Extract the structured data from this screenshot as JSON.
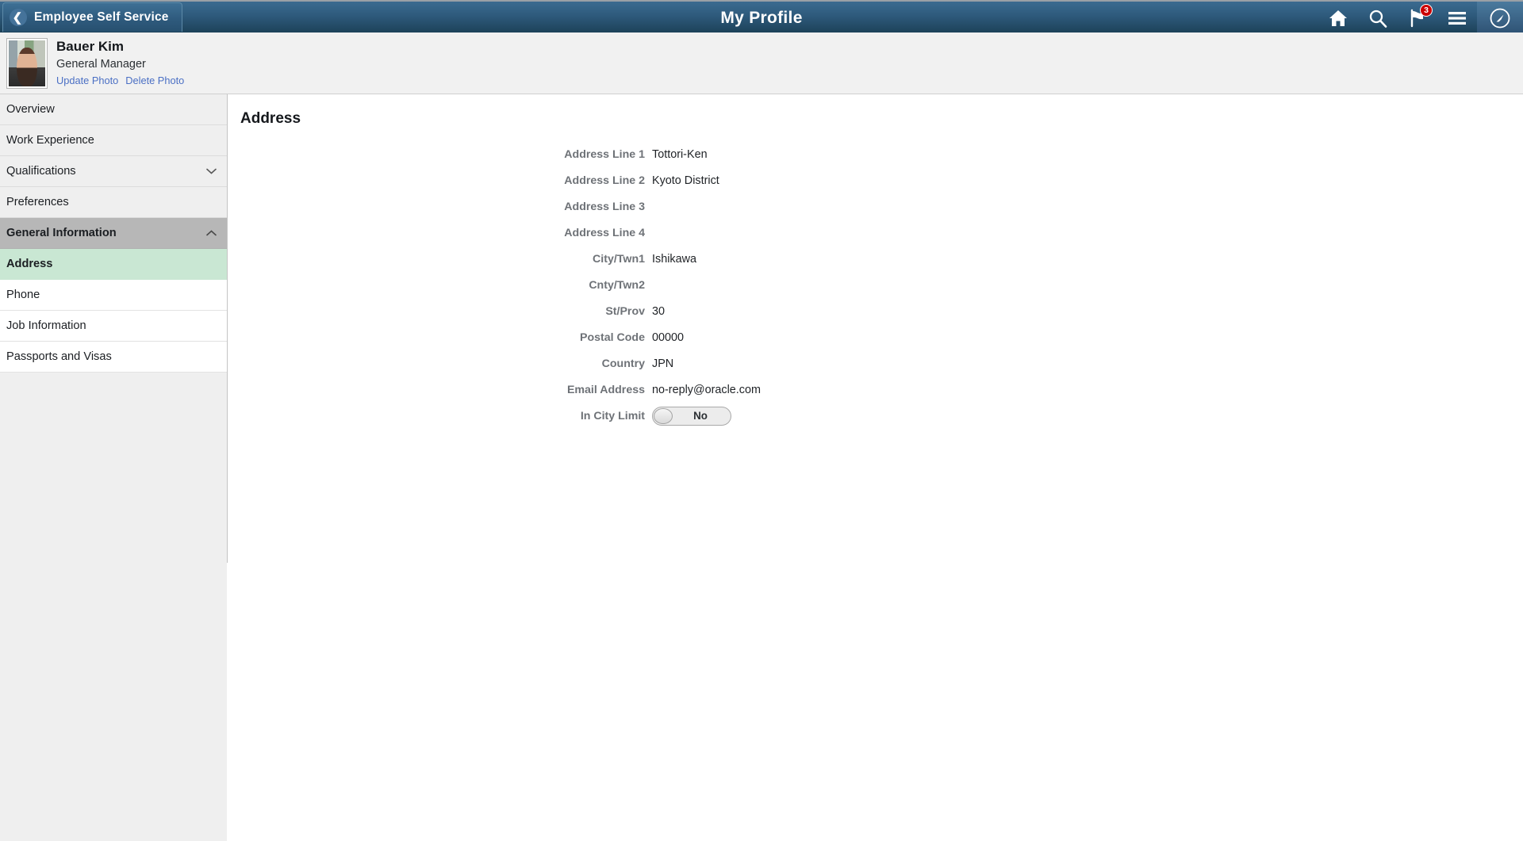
{
  "header": {
    "back_label": "Employee Self Service",
    "back_icon": "chevron-left-icon",
    "title": "My Profile",
    "icons": [
      {
        "name": "home-icon",
        "label": "Home"
      },
      {
        "name": "search-icon",
        "label": "Search"
      },
      {
        "name": "notifications-flag-icon",
        "label": "Notifications",
        "badge": "3"
      },
      {
        "name": "actions-menu-icon",
        "label": "Actions List"
      },
      {
        "name": "navbar-compass-icon",
        "label": "NavBar"
      }
    ],
    "colors": {
      "bar_top": "#3b6b90",
      "bar_bottom": "#1d4259",
      "badge": "#cc0000"
    }
  },
  "profile": {
    "avatar_name": "employee-photo",
    "name": "Bauer Kim",
    "role": "General Manager",
    "links": [
      {
        "name": "update-photo-link",
        "label": "Update Photo"
      },
      {
        "name": "delete-photo-link",
        "label": "Delete Photo"
      }
    ],
    "link_color": "#4a6fc4"
  },
  "sidebar": {
    "items": [
      {
        "name": "sidebar-item-overview",
        "label": "Overview",
        "type": "item",
        "state": "normal",
        "chevron": ""
      },
      {
        "name": "sidebar-item-work-experience",
        "label": "Work Experience",
        "type": "item",
        "state": "normal",
        "chevron": ""
      },
      {
        "name": "sidebar-item-qualifications",
        "label": "Qualifications",
        "type": "group",
        "state": "collapsed",
        "chevron": "chevron-down-icon"
      },
      {
        "name": "sidebar-item-preferences",
        "label": "Preferences",
        "type": "item",
        "state": "normal",
        "chevron": ""
      },
      {
        "name": "sidebar-item-general-information",
        "label": "General Information",
        "type": "group",
        "state": "expanded",
        "chevron": "chevron-up-icon"
      },
      {
        "name": "sidebar-item-address",
        "label": "Address",
        "type": "sub",
        "state": "selected",
        "chevron": ""
      },
      {
        "name": "sidebar-item-phone",
        "label": "Phone",
        "type": "sub",
        "state": "normal",
        "chevron": ""
      },
      {
        "name": "sidebar-item-job-information",
        "label": "Job Information",
        "type": "sub",
        "state": "normal",
        "chevron": ""
      },
      {
        "name": "sidebar-item-passports-and-visas",
        "label": "Passports and Visas",
        "type": "sub",
        "state": "normal",
        "chevron": ""
      }
    ],
    "colors": {
      "background": "#efefef",
      "group_selected": "#b7b7b7",
      "item_selected": "#c9e7d3",
      "sub_background": "#ffffff"
    }
  },
  "main": {
    "title": "Address",
    "fields": [
      {
        "name": "field-address-line-1",
        "label": "Address Line 1",
        "value": "Tottori-Ken",
        "control": "text"
      },
      {
        "name": "field-address-line-2",
        "label": "Address Line 2",
        "value": "Kyoto District",
        "control": "text"
      },
      {
        "name": "field-address-line-3",
        "label": "Address Line 3",
        "value": "",
        "control": "text"
      },
      {
        "name": "field-address-line-4",
        "label": "Address Line 4",
        "value": "",
        "control": "text"
      },
      {
        "name": "field-city-twn1",
        "label": "City/Twn1",
        "value": "Ishikawa",
        "control": "text"
      },
      {
        "name": "field-cnty-twn2",
        "label": "Cnty/Twn2",
        "value": "",
        "control": "text"
      },
      {
        "name": "field-st-prov",
        "label": "St/Prov",
        "value": "30",
        "control": "text"
      },
      {
        "name": "field-postal-code",
        "label": "Postal Code",
        "value": "00000",
        "control": "text"
      },
      {
        "name": "field-country",
        "label": "Country",
        "value": "JPN",
        "control": "text"
      },
      {
        "name": "field-email-address",
        "label": "Email Address",
        "value": "no-reply@oracle.com",
        "control": "text"
      },
      {
        "name": "field-in-city-limit",
        "label": "In City Limit",
        "value": "No",
        "control": "toggle",
        "toggle_state": "off"
      }
    ]
  }
}
